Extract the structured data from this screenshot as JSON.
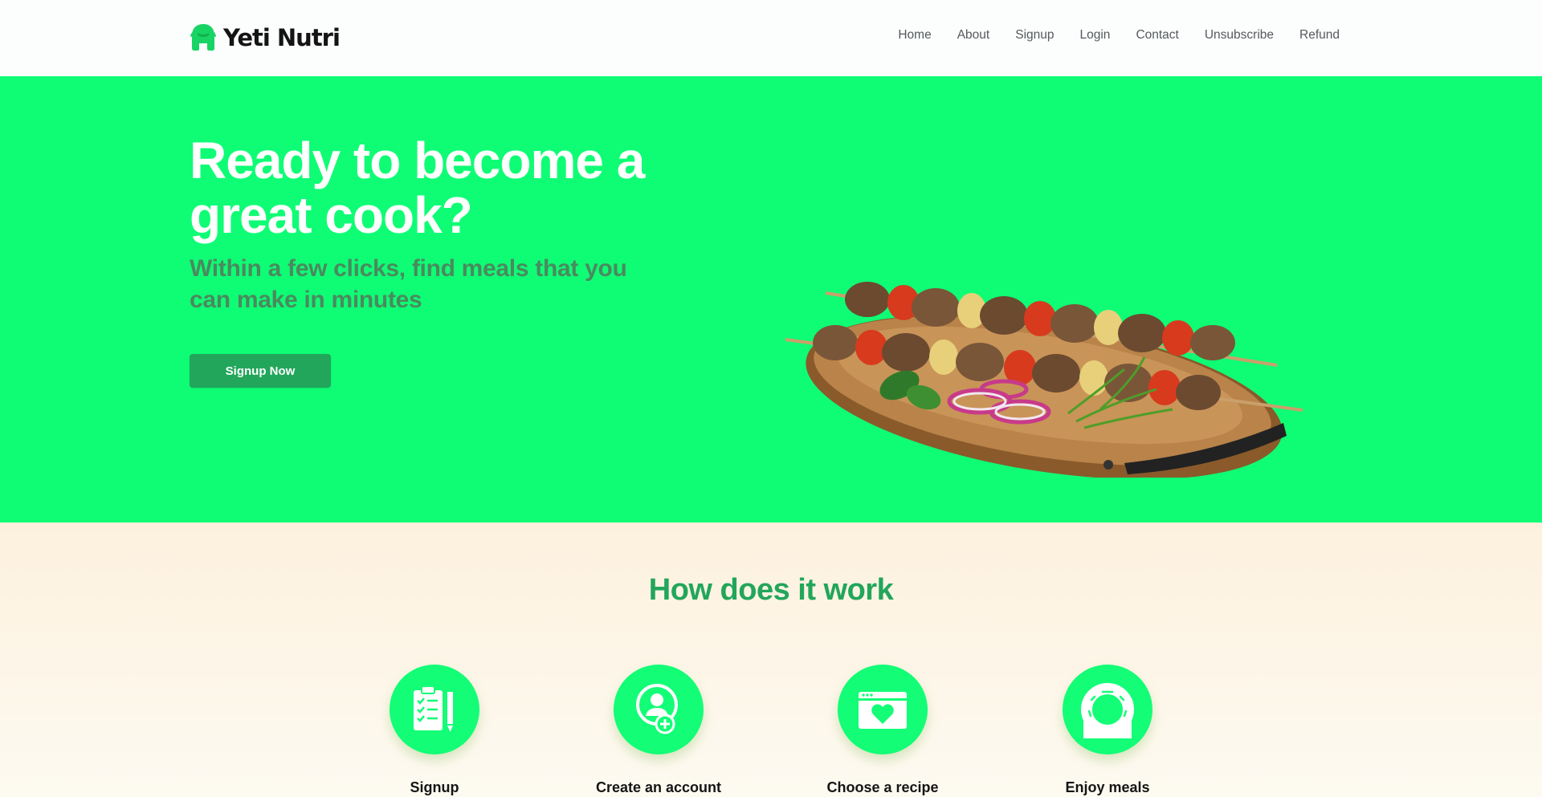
{
  "brand": {
    "name": "Yeti Nutri",
    "logo_icon": "yeti-logo-icon",
    "accent": "#0ffd75"
  },
  "nav": {
    "items": [
      {
        "label": "Home"
      },
      {
        "label": "About"
      },
      {
        "label": "Signup"
      },
      {
        "label": "Login"
      },
      {
        "label": "Contact"
      },
      {
        "label": "Unsubscribe"
      },
      {
        "label": "Refund"
      }
    ]
  },
  "hero": {
    "title": "Ready to become a great cook?",
    "subtitle": "Within a few clicks, find meals that you can make in minutes",
    "cta_label": "Signup Now",
    "image": "kebab-platter-image",
    "background": "#0ffd75",
    "button_color": "#22a65b"
  },
  "how": {
    "title": "How does it work",
    "title_color": "#22a65b",
    "steps": [
      {
        "label": "Signup",
        "icon": "clipboard-checklist-icon"
      },
      {
        "label": "Create an account",
        "icon": "add-user-icon"
      },
      {
        "label": "Choose a recipe",
        "icon": "browser-heart-icon"
      },
      {
        "label": "Enjoy meals",
        "icon": "donut-icon"
      }
    ]
  }
}
